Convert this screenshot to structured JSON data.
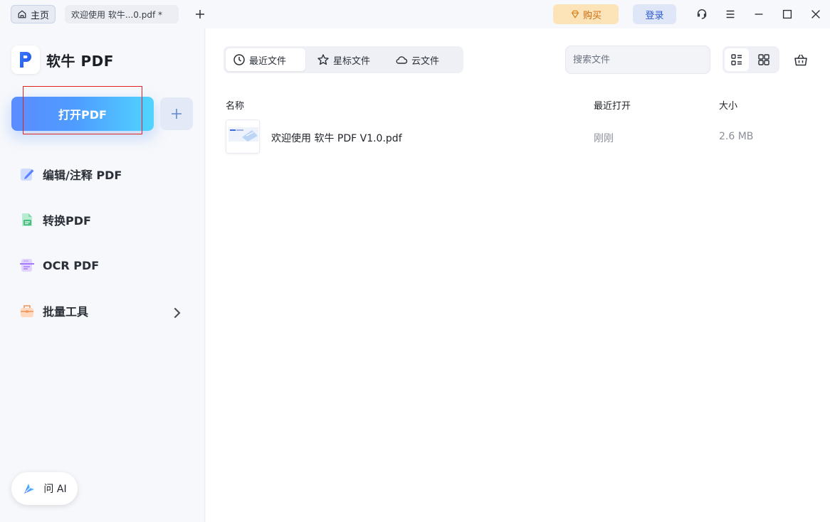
{
  "titlebar": {
    "home_tab": "主页",
    "doc_tab": "欢迎使用 软牛...0.pdf *",
    "buy_label": "购买",
    "login_label": "登录"
  },
  "sidebar": {
    "brand": "软牛 PDF",
    "open_label": "打开PDF",
    "items": [
      {
        "label": "编辑/注释 PDF",
        "icon": "edit-icon"
      },
      {
        "label": "转换PDF",
        "icon": "convert-icon"
      },
      {
        "label": "OCR PDF",
        "icon": "ocr-icon"
      },
      {
        "label": "批量工具",
        "icon": "toolbox-icon"
      }
    ],
    "ai_label": "问 AI"
  },
  "main": {
    "tabs": [
      {
        "label": "最近文件",
        "icon": "clock-icon",
        "active": true
      },
      {
        "label": "星标文件",
        "icon": "star-icon",
        "active": false
      },
      {
        "label": "云文件",
        "icon": "cloud-icon",
        "active": false
      }
    ],
    "search_placeholder": "搜索文件",
    "columns": {
      "name": "名称",
      "recent": "最近打开",
      "size": "大小"
    },
    "files": [
      {
        "name": "欢迎使用 软牛 PDF V1.0.pdf",
        "opened": "刚刚",
        "size": "2.6 MB"
      }
    ]
  },
  "colors": {
    "accent": "#4e9cff",
    "buy_bg": "#fde3b8",
    "buy_text": "#c96b0c",
    "login_bg": "#dfe6f8",
    "login_text": "#2c5ccf"
  }
}
